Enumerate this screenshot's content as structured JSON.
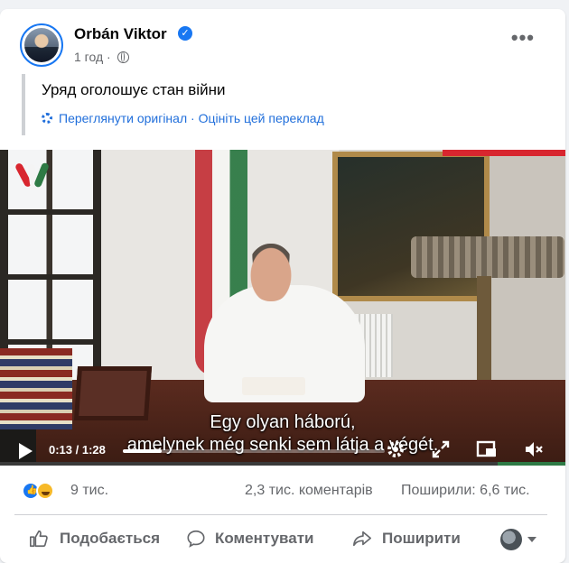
{
  "post": {
    "author": "Orbán Viktor",
    "time": "1 год",
    "text": "Уряд оголошує стан війни",
    "translate": {
      "see_original": "Переглянути оригінал",
      "separator": "·",
      "rate_translation": "Оцініть цей переклад"
    }
  },
  "video": {
    "subtitle_line1": "Egy olyan háború,",
    "subtitle_line2": "amelynek még senki sem látja a végét.",
    "current_time": "0:13",
    "duration": "1:28",
    "progress_fraction": 0.148,
    "logo_text": ""
  },
  "stats": {
    "reactions": "9 тис.",
    "comments": "2,3 тис. коментарів",
    "shares": "Поширили: 6,6 тис."
  },
  "actions": {
    "like": "Подобається",
    "comment": "Коментувати",
    "share": "Поширити"
  },
  "colors": {
    "accent": "#1877f2",
    "link": "#216fdb",
    "muted_text": "#65676b"
  },
  "icons": {
    "verified": "verified-badge-icon",
    "globe": "globe-icon",
    "more": "more-options-icon",
    "gear": "gear-icon",
    "play": "play-icon",
    "settings": "settings-gear-icon",
    "fullscreen": "fullscreen-icon",
    "pip": "picture-in-picture-icon",
    "mute": "mute-icon",
    "like": "thumbs-up-icon",
    "comment": "comment-bubble-icon",
    "share": "share-arrow-icon"
  }
}
